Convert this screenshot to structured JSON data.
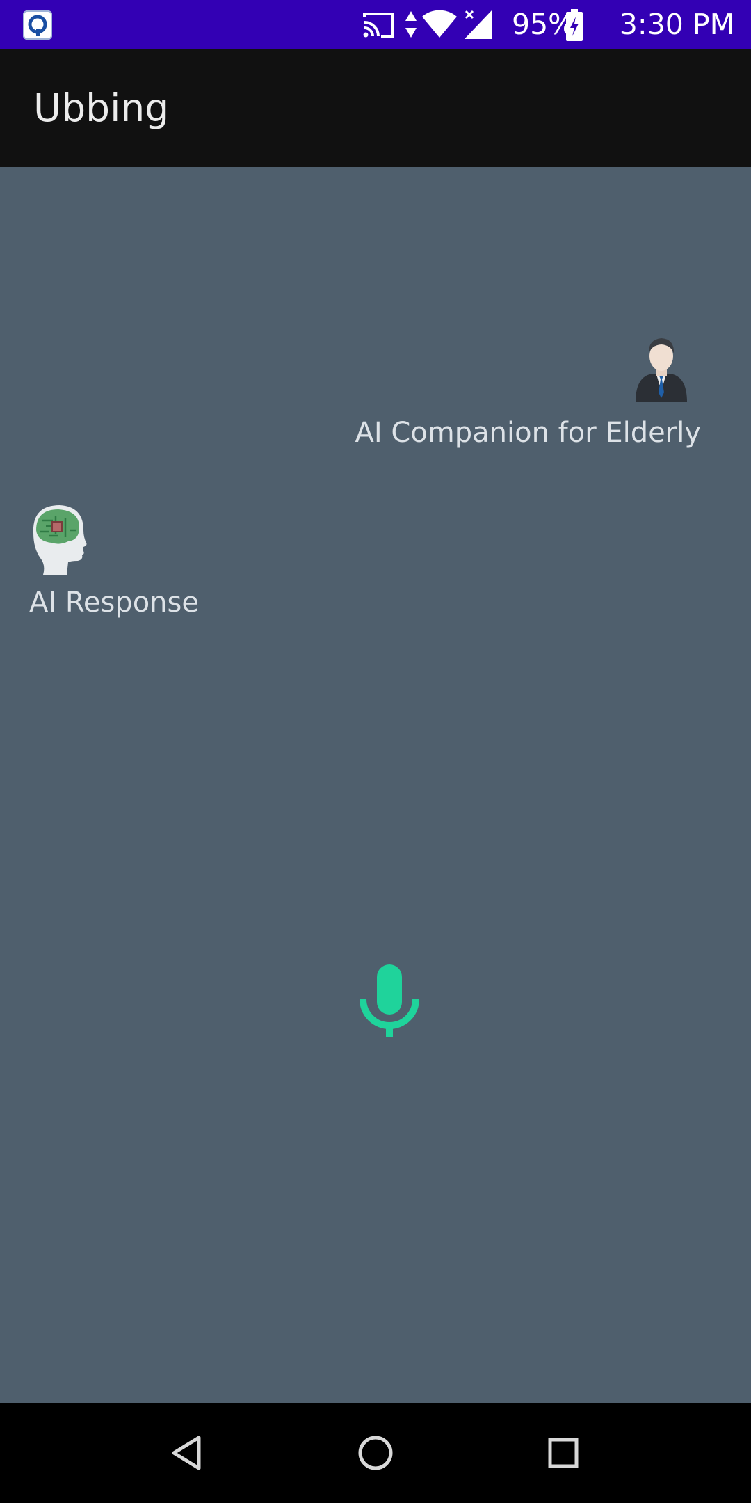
{
  "status_bar": {
    "app_icon": "q-app-icon",
    "icons": [
      "cast-icon",
      "data-updown-icon",
      "wifi-icon",
      "signal-icon",
      "battery-charging-icon"
    ],
    "battery_percent": "95%",
    "time": "3:30 PM",
    "background_color": "#3300b4"
  },
  "app_bar": {
    "title": "Ubbing",
    "background_color": "#111111"
  },
  "conversation": {
    "companion": {
      "avatar": "businessman-avatar-icon",
      "label": "AI Companion for Elderly"
    },
    "ai_response": {
      "avatar": "ai-brain-head-icon",
      "label": "AI Response"
    },
    "background_color": "#4f5f6d"
  },
  "mic": {
    "icon": "microphone-icon",
    "color": "#1fd39b"
  },
  "nav_bar": {
    "buttons": [
      "back-icon",
      "home-icon",
      "recents-icon"
    ]
  }
}
